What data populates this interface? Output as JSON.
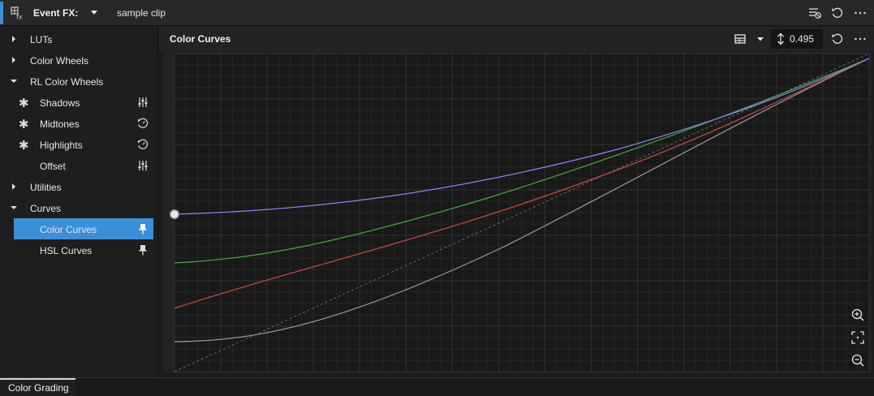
{
  "header": {
    "event_label": "Event FX:",
    "clip_name": "sample clip"
  },
  "icons": {
    "fx": "fx-icon",
    "dropdown": "chevron-down-icon",
    "filter": "filter-list-icon",
    "reset": "reset-icon",
    "more": "more-horizontal-icon",
    "grid_view": "grid-view-icon",
    "vertical_arrows": "vertical-arrows-icon",
    "zoom_in": "zoom-in-icon",
    "fit": "fit-to-view-icon",
    "zoom_out": "zoom-out-icon"
  },
  "sidebar": {
    "items": [
      {
        "label": "LUTs",
        "state": "collapsed"
      },
      {
        "label": "Color Wheels",
        "state": "collapsed"
      },
      {
        "label": "RL Color Wheels",
        "state": "expanded"
      },
      {
        "label": "Shadows",
        "prefix": "star",
        "right_icon": "sliders-icon"
      },
      {
        "label": "Midtones",
        "prefix": "star",
        "right_icon": "reset-circle-icon"
      },
      {
        "label": "Highlights",
        "prefix": "star",
        "right_icon": "reset-circle-icon"
      },
      {
        "label": "Offset",
        "right_icon": "sliders-icon"
      },
      {
        "label": "Utilities",
        "state": "collapsed"
      },
      {
        "label": "Curves",
        "state": "expanded"
      },
      {
        "label": "Color Curves",
        "selected": true,
        "right_icon": "pin-icon"
      },
      {
        "label": "HSL Curves",
        "right_icon": "pin-icon"
      }
    ]
  },
  "panel": {
    "title": "Color Curves",
    "value": "0.495"
  },
  "colors": {
    "accent": "#3a8fd9",
    "curve_blue": "#8b86ff",
    "curve_green": "#3fae3f",
    "curve_red": "#d04848",
    "curve_luma": "#9a9a9a"
  },
  "footer": {
    "tab_label": "Color Grading"
  }
}
